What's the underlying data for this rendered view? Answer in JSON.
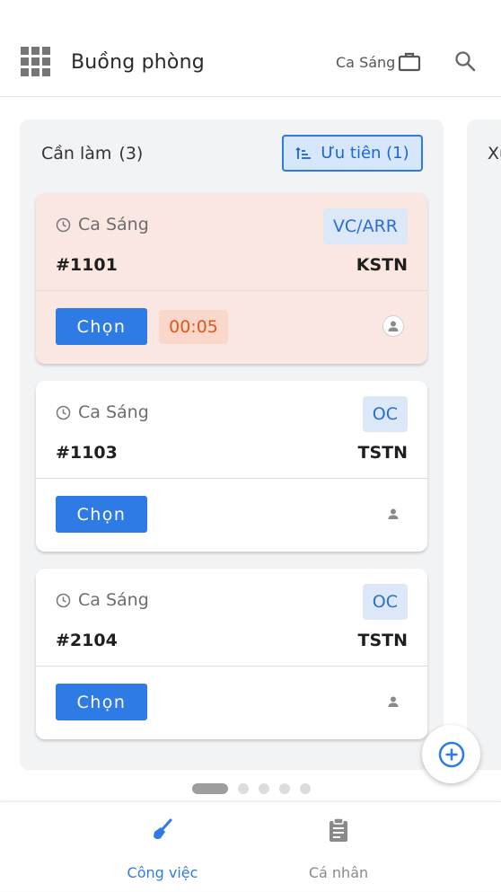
{
  "header": {
    "title": "Buồng phòng",
    "shift": "Ca Sáng"
  },
  "column": {
    "title": "Cần làm",
    "count": "(3)",
    "priority_label": "Ưu tiên (1)",
    "next_column_peek": "Xu"
  },
  "cards": [
    {
      "shift": "Ca Sáng",
      "status": "VC/ARR",
      "room": "#1101",
      "room_type": "KSTN",
      "action": "Chọn",
      "timer": "00:05",
      "urgent": true
    },
    {
      "shift": "Ca Sáng",
      "status": "OC",
      "room": "#1103",
      "room_type": "TSTN",
      "action": "Chọn",
      "urgent": false
    },
    {
      "shift": "Ca Sáng",
      "status": "OC",
      "room": "#2104",
      "room_type": "TSTN",
      "action": "Chọn",
      "urgent": false
    }
  ],
  "pager": {
    "pages": 5,
    "current": 1
  },
  "bottom_nav": [
    {
      "label": "Công việc",
      "icon": "broom-icon",
      "active": true
    },
    {
      "label": "Cá nhân",
      "icon": "clipboard-icon",
      "active": false
    }
  ],
  "colors": {
    "accent": "#2f7be5",
    "urgent_bg": "#fbe7e2",
    "timer_text": "#e2561f",
    "status_bg": "#dce8f7"
  }
}
